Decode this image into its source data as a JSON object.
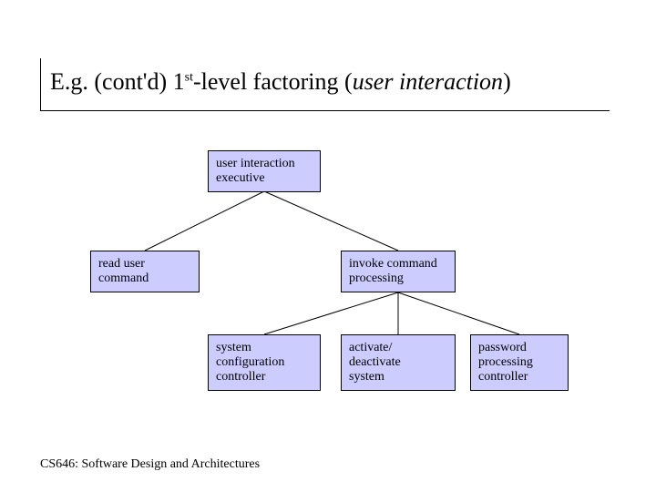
{
  "title": {
    "pre": "E.g. (cont'd) 1",
    "sup": "st",
    "mid": "-level factoring (",
    "ital": "user interaction",
    "post": ")"
  },
  "nodes": {
    "root": {
      "line1": "user interaction",
      "line2": "executive"
    },
    "left": {
      "line1": "read user",
      "line2": "command"
    },
    "right": {
      "line1": "invoke command",
      "line2": "processing"
    },
    "c1": {
      "line1": "system",
      "line2": "configuration",
      "line3": "controller"
    },
    "c2": {
      "line1": "activate/",
      "line2": "deactivate",
      "line3": "system"
    },
    "c3": {
      "line1": "password",
      "line2": "processing",
      "line3": "controller"
    }
  },
  "footer": "CS646: Software Design and Architectures",
  "colors": {
    "box_fill": "#ccccff"
  }
}
